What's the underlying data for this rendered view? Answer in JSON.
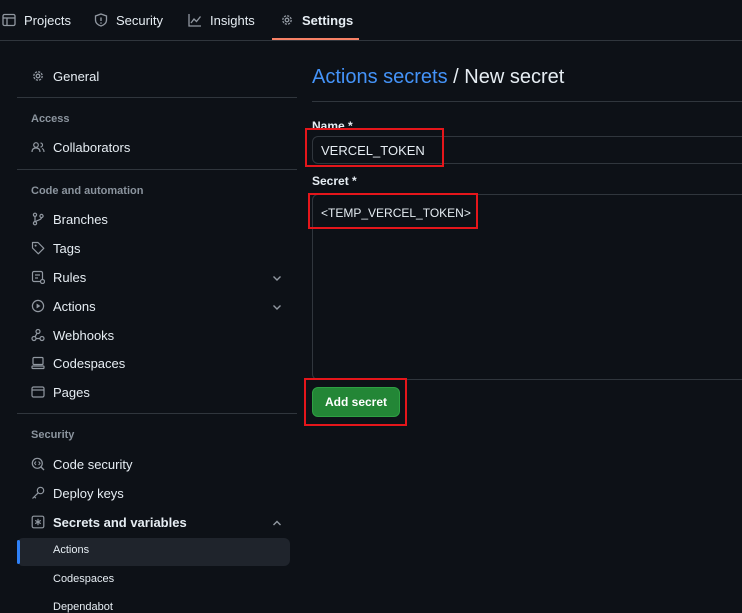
{
  "topnav": {
    "tabs": [
      {
        "label": "Projects",
        "icon": "table-icon"
      },
      {
        "label": "Security",
        "icon": "shield-icon"
      },
      {
        "label": "Insights",
        "icon": "graph-icon"
      },
      {
        "label": "Settings",
        "icon": "gear-icon",
        "active": true
      }
    ]
  },
  "sidebar": {
    "general": "General",
    "access_heading": "Access",
    "collaborators": "Collaborators",
    "code_heading": "Code and automation",
    "branches": "Branches",
    "tags": "Tags",
    "rules": "Rules",
    "actions": "Actions",
    "webhooks": "Webhooks",
    "codespaces": "Codespaces",
    "pages": "Pages",
    "security_heading": "Security",
    "code_security": "Code security",
    "deploy_keys": "Deploy keys",
    "secrets_vars": "Secrets and variables",
    "sub_actions": "Actions",
    "sub_codespaces": "Codespaces",
    "sub_dependabot": "Dependabot"
  },
  "main": {
    "breadcrumb_link": "Actions secrets",
    "breadcrumb_sep": " / ",
    "breadcrumb_current": "New secret",
    "name_label": "Name *",
    "name_value": "VERCEL_TOKEN",
    "secret_label": "Secret *",
    "secret_value": "<TEMP_VERCEL_TOKEN>",
    "add_button": "Add secret"
  },
  "colors": {
    "background": "#0d1117",
    "accent_link": "#4493f8",
    "primary_button": "#238636",
    "active_tab_underline": "#f78166",
    "highlight_box": "#e5161b"
  }
}
